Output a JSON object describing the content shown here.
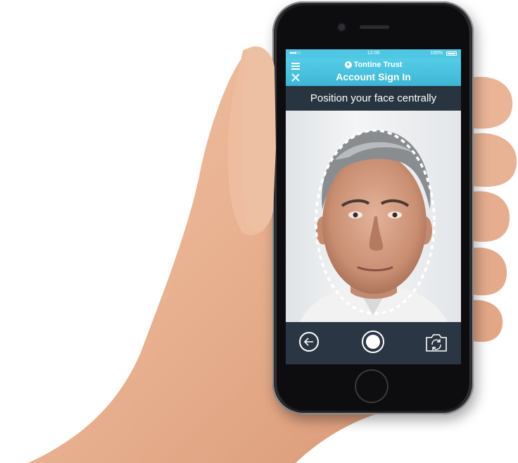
{
  "status_bar": {
    "signal": "●●●○○",
    "time": "12:00",
    "battery": "100%"
  },
  "header": {
    "brand": "Tontine Trust",
    "brand_icon": "lock-icon",
    "title": "Account Sign In",
    "menu_icon": "hamburger-menu-icon",
    "close_icon": "close-icon"
  },
  "instruction": "Position your face centrally",
  "controls": {
    "back_icon": "arrow-left-circle-icon",
    "shutter_icon": "shutter-icon",
    "flip_icon": "camera-flip-icon"
  },
  "colors": {
    "accent": "#4fc6e4",
    "dark_bar": "#283440",
    "controls_bg": "#2a3643"
  }
}
